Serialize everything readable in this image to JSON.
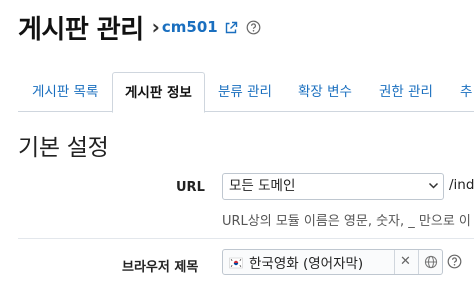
{
  "header": {
    "title": "게시판 관리",
    "chevron": "›",
    "module_id": "cm501",
    "external_link_icon": "external-link-icon",
    "help_icon": "question-circle-icon"
  },
  "tabs": [
    {
      "label": "게시판 목록",
      "active": false
    },
    {
      "label": "게시판 정보",
      "active": true
    },
    {
      "label": "분류 관리",
      "active": false
    },
    {
      "label": "확장 변수",
      "active": false
    },
    {
      "label": "권한 관리",
      "active": false
    },
    {
      "label": "추",
      "active": false
    }
  ],
  "section": {
    "title": "기본 설정"
  },
  "url_row": {
    "label": "URL",
    "domain_select_value": "모든 도메인",
    "url_suffix": "/inde",
    "help_text": "URL상의 모듈 이름은 영문, 숫자, _ 만으로 이"
  },
  "browser_title_row": {
    "label": "브라우저 제목",
    "lang_flag": "korea-flag-icon",
    "value": "한국영화 (영어자막)",
    "clear_label": "✕",
    "globe_icon": "globe-icon",
    "help_icon": "question-circle-icon"
  },
  "colors": {
    "link": "#1a6fbf",
    "border": "#cfd6de"
  }
}
